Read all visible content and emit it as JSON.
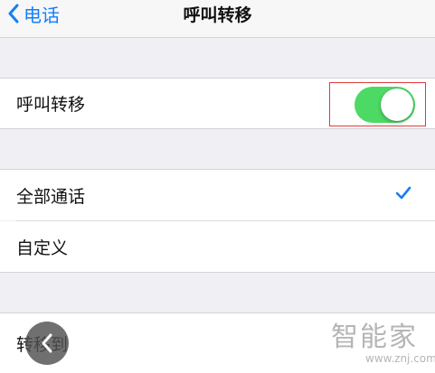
{
  "nav": {
    "back_label": "电话",
    "title": "呼叫转移"
  },
  "call_forwarding": {
    "label": "呼叫转移",
    "toggle_on": true,
    "toggle_color": "#4cd964"
  },
  "options": [
    {
      "label": "全部通话",
      "selected": true
    },
    {
      "label": "自定义",
      "selected": false
    }
  ],
  "forward_to": {
    "label": "转移到"
  },
  "watermark": {
    "brand": "智能家",
    "url": "www.znj.com"
  },
  "colors": {
    "accent": "#147efb",
    "background": "#efeff4",
    "highlight_box": "#e03a3a"
  },
  "icons": {
    "back": "chevron-left-icon",
    "check": "checkmark-icon",
    "floating_back": "chevron-left-icon"
  }
}
